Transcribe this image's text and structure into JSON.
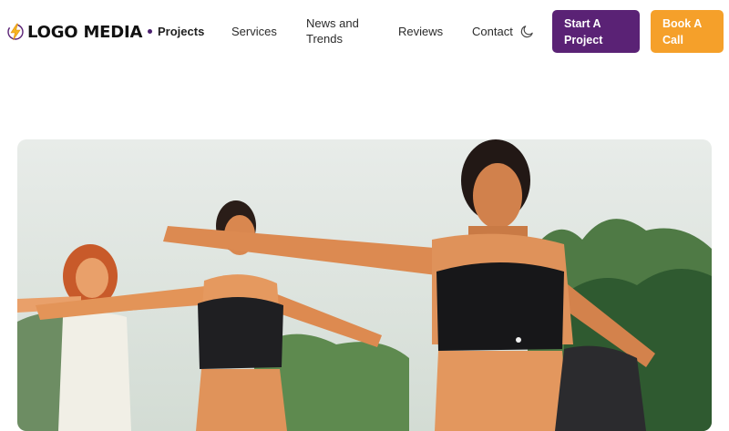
{
  "brand": {
    "name": "LOGO MEDIA",
    "icon": "lightning-bolt-icon"
  },
  "nav": {
    "items": [
      {
        "label": "Projects",
        "active": true
      },
      {
        "label": "Services"
      },
      {
        "label": "News and Trends"
      },
      {
        "label": "Reviews"
      },
      {
        "label": "Contact"
      }
    ],
    "theme_toggle_icon": "moon-icon"
  },
  "cta": {
    "start_project": "Start A Project",
    "book_call": "Book A Call"
  },
  "colors": {
    "primary": "#5a2275",
    "accent": "#f5a02a"
  },
  "hero": {
    "image": "group of women doing yoga warrior pose outdoors"
  }
}
